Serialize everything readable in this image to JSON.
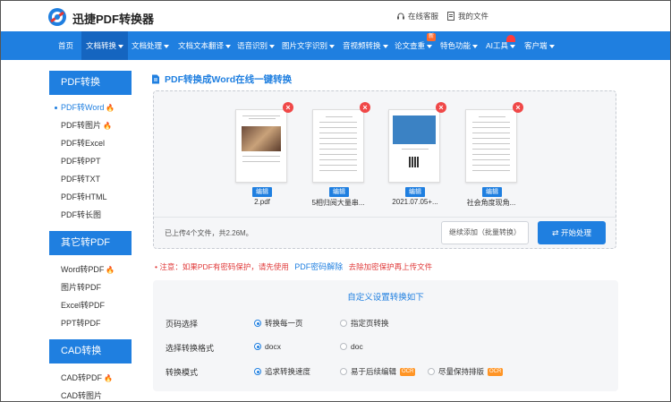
{
  "header": {
    "brand": "迅捷PDF转换器",
    "service_link": "在线客服",
    "files_link": "我的文件"
  },
  "nav": {
    "items": [
      {
        "label": "首页",
        "caret": false
      },
      {
        "label": "文档转换",
        "caret": true
      },
      {
        "label": "文档处理",
        "caret": true
      },
      {
        "label": "文档文本翻译",
        "caret": true
      },
      {
        "label": "语音识别",
        "caret": true
      },
      {
        "label": "图片文字识别",
        "caret": true
      },
      {
        "label": "音视频转换",
        "caret": true
      },
      {
        "label": "论文查重",
        "caret": true
      },
      {
        "label": "特色功能",
        "caret": true
      },
      {
        "label": "AI工具",
        "caret": true
      },
      {
        "label": "客户端",
        "caret": true
      }
    ],
    "new_badge": "新",
    "accent": "#1f7fe0"
  },
  "sidebar": {
    "sections": [
      {
        "title": "PDF转换",
        "items": [
          {
            "label": "PDF转Word",
            "hot": true,
            "active": true
          },
          {
            "label": "PDF转图片",
            "hot": true
          },
          {
            "label": "PDF转Excel"
          },
          {
            "label": "PDF转PPT"
          },
          {
            "label": "PDF转TXT"
          },
          {
            "label": "PDF转HTML"
          },
          {
            "label": "PDF转长图"
          }
        ]
      },
      {
        "title": "其它转PDF",
        "items": [
          {
            "label": "Word转PDF",
            "hot": true
          },
          {
            "label": "图片转PDF"
          },
          {
            "label": "Excel转PDF"
          },
          {
            "label": "PPT转PDF"
          }
        ]
      },
      {
        "title": "CAD转换",
        "items": [
          {
            "label": "CAD转PDF",
            "hot": true
          },
          {
            "label": "CAD转图片"
          }
        ]
      }
    ]
  },
  "main": {
    "title": "PDF转换成Word在线一键转换",
    "files": [
      {
        "name": "2.pdf",
        "edit": "编辑",
        "thumb": "photo"
      },
      {
        "name": "5相归阅大量串...",
        "edit": "编辑",
        "thumb": "text"
      },
      {
        "name": "2021.07.05+...",
        "edit": "编辑",
        "thumb": "blue"
      },
      {
        "name": "社会角度现角...",
        "edit": "编辑",
        "thumb": "text"
      }
    ],
    "close_glyph": "×",
    "upload_info": "已上传4个文件，共2.26M。",
    "add_button": "继续添加（批量转换）",
    "start_button": "开始处理"
  },
  "notice": {
    "prefix": "注意：如果PDF有密码保护，请先使用",
    "link": "PDF密码解除",
    "suffix": "去除加密保护再上传文件"
  },
  "settings": {
    "title": "自定义设置转换如下",
    "rows": [
      {
        "label": "页码选择",
        "options": [
          {
            "text": "转换每一页",
            "selected": true
          },
          {
            "text": "指定页转换",
            "selected": false
          }
        ]
      },
      {
        "label": "选择转换格式",
        "options": [
          {
            "text": "docx",
            "selected": true
          },
          {
            "text": "doc",
            "selected": false
          }
        ]
      },
      {
        "label": "转换模式",
        "options": [
          {
            "text": "追求转换速度",
            "selected": true
          },
          {
            "text": "易于后续编辑",
            "selected": false,
            "tag": "OCR"
          },
          {
            "text": "尽量保持排版",
            "selected": false,
            "tag": "OCR"
          }
        ]
      }
    ]
  }
}
